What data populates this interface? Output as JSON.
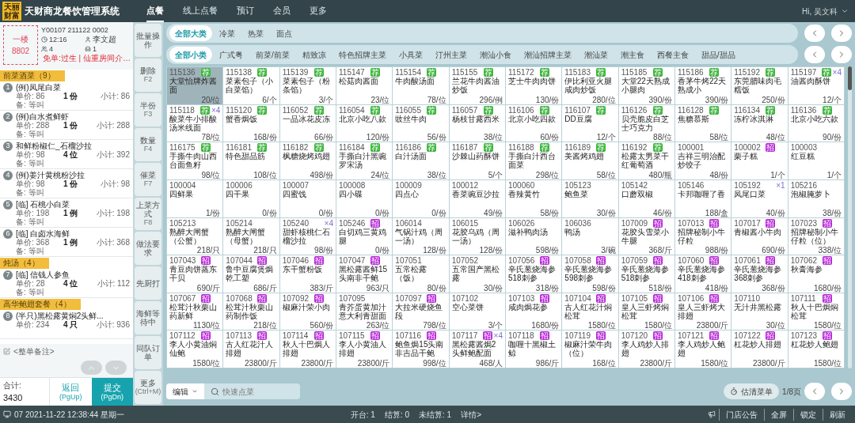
{
  "logo_lines": [
    "天丽",
    "财富"
  ],
  "title": "天财商龙餐饮管理系统",
  "nav": [
    {
      "label": "点餐",
      "selected": true
    },
    {
      "label": "线上点餐",
      "selected": false
    },
    {
      "label": "预订",
      "selected": false
    },
    {
      "label": "会员",
      "selected": false
    },
    {
      "label": "更多",
      "selected": false
    }
  ],
  "user": "Hi, 吴文科",
  "order": {
    "table_area": "一楼",
    "table_no": "8802",
    "bill_no": "Y00107 211122 0002",
    "time": "12:16",
    "waiter": "李文超",
    "guests": "4",
    "seats": "1",
    "remark": "免单:过生 | 仙重房间介…"
  },
  "groups": [
    {
      "title": "前菜酒菜（9）",
      "items": [
        {
          "index": "1",
          "name": "(例)凤尾白菜",
          "unit_price": "单价: 86",
          "qty": "1 份",
          "subtotal": "小计: 86",
          "note": "备: 等叫"
        },
        {
          "index": "2",
          "name": "(例)白水煮鲜虾",
          "unit_price": "单价: 288",
          "qty": "1 份",
          "subtotal": "小计: 288",
          "note": "备: 等叫"
        },
        {
          "index": "3",
          "name": "和鲜粉椒仁_石榴沙拉",
          "unit_price": "单价: 98",
          "qty": "4 位",
          "subtotal": "小计: 392",
          "note": "备: 等叫"
        },
        {
          "index": "4",
          "name": "(例)姜汁黄桃粉沙拉",
          "unit_price": "单价: 98",
          "qty": "1 份",
          "subtotal": "小计: 98",
          "note": "备: 等叫"
        },
        {
          "index": "5",
          "name": "[临] 石桃小白菜",
          "unit_price": "单价: 198",
          "qty": "1 例",
          "subtotal": "小计: 198",
          "note": "备: 等叫"
        },
        {
          "index": "6",
          "name": "[临] 白卤水海鲜",
          "unit_price": "单价: 368",
          "qty": "1 例",
          "subtotal": "小计: 368",
          "note": "备: 等叫"
        }
      ]
    },
    {
      "title": "炖汤（4）",
      "items": [
        {
          "index": "7",
          "name": "[临] 信钱人参鱼",
          "unit_price": "单价: 28",
          "qty": "4 位",
          "subtotal": "小计: 112",
          "note": "备: 等叫"
        }
      ]
    },
    {
      "title": "高华鲍翅套餐（4）",
      "items": [
        {
          "index": "8",
          "name": "(半只)黑松露黄焖2头鲜...",
          "unit_price": "单价: 234",
          "qty": "4 只",
          "subtotal": "小计: 936"
        }
      ]
    }
  ],
  "order_note": "<整单备注>",
  "total_label": "合计:",
  "total": "3430",
  "buttons": [
    {
      "label": "返回",
      "key": "(PgUp)",
      "kind": "secondary"
    },
    {
      "label": "提交",
      "key": "(PgDn)",
      "kind": "primary"
    }
  ],
  "actions": [
    {
      "label": "批量操作"
    },
    {
      "label": "删除",
      "key": "F2"
    },
    {
      "label": "半份",
      "key": "F3"
    },
    {
      "label": "数量",
      "key": "F4"
    },
    {
      "label": "催菜",
      "key": "F7"
    },
    {
      "label": "上菜方式",
      "key": "F8"
    },
    {
      "label": "做法要求"
    },
    {
      "label": "先厨打"
    },
    {
      "label": "海鲜等待中"
    },
    {
      "label": "同队订单"
    },
    {
      "label": "更多",
      "key": "(Ctrl+M)"
    }
  ],
  "categories": [
    {
      "label": "全部大类",
      "selected": true
    },
    {
      "label": "冷菜",
      "selected": false
    },
    {
      "label": "热菜",
      "selected": false
    },
    {
      "label": "面点",
      "selected": false
    }
  ],
  "subcategories": [
    {
      "label": "全部小类",
      "selected": true
    },
    {
      "label": "广式粤",
      "selected": false
    },
    {
      "label": "前菜/前菜",
      "selected": false
    },
    {
      "label": "精致凉",
      "selected": false
    },
    {
      "label": "特色招牌主菜",
      "selected": false
    },
    {
      "label": "小具菜",
      "selected": false
    },
    {
      "label": "汀州主菜",
      "selected": false
    },
    {
      "label": "潮汕小食",
      "selected": false
    },
    {
      "label": "潮汕招牌主菜",
      "selected": false
    },
    {
      "label": "潮汕菜",
      "selected": false
    },
    {
      "label": "潮主食",
      "selected": false
    },
    {
      "label": "西餐主食",
      "selected": false
    },
    {
      "label": "甜品/甜品",
      "selected": false
    }
  ],
  "dishes": [
    {
      "code": "115136",
      "name": "大堂怡牌炸酱面",
      "price": "20/位",
      "tag": {
        "text": "荐",
        "color": "#3cb43c"
      },
      "selected": true
    },
    {
      "code": "115138",
      "name": "菜素包子（小白菜馅）",
      "price": "6/个",
      "tag": {
        "text": "荐",
        "color": "#3cb43c"
      },
      "selected": false
    },
    {
      "code": "115139",
      "name": "菜素包子（粉条馅）",
      "price": "3/个",
      "tag": {
        "text": "荐",
        "color": "#3cb43c"
      },
      "selected": false
    },
    {
      "code": "115147",
      "name": "松菇肉酱面",
      "price": "23/位",
      "tag": {
        "text": "荐",
        "color": "#3cb43c"
      },
      "selected": false
    },
    {
      "code": "115154",
      "name": "牛肉酸汤面",
      "price": "78/位",
      "tag": {
        "text": "荐",
        "color": "#3cb43c"
      },
      "selected": false
    },
    {
      "code": "115155",
      "name": "兰花牛肉酱油炒饭",
      "price": "296/例",
      "tag": {
        "text": "荐",
        "color": "#3cb43c"
      },
      "selected": false
    },
    {
      "code": "115172",
      "name": "芝士牛肉肉饼",
      "price": "130/份",
      "tag": {
        "text": "荐",
        "color": "#3cb43c"
      },
      "selected": false
    },
    {
      "code": "115183",
      "name": "伊比利亚火腿咸肉炒饭",
      "price": "280/位",
      "tag": {
        "text": "荐",
        "color": "#3cb43c"
      },
      "selected": false
    },
    {
      "code": "115185",
      "name": "大堂22天熟成小腿肉",
      "price": "390/份",
      "tag": {
        "text": "荐",
        "color": "#3cb43c"
      },
      "selected": false
    },
    {
      "code": "115186",
      "name": "香茅牛烤22天熟成小",
      "price": "390/份",
      "tag": {
        "text": "荐",
        "color": "#3cb43c"
      },
      "selected": false
    },
    {
      "code": "115192",
      "name": "东莞腊味肉毛糯饭",
      "price": "250/份",
      "tag": {
        "text": "荐",
        "color": "#3cb43c"
      },
      "selected": false
    },
    {
      "code": "115197",
      "name": "油酱肉酥饼",
      "price": "12/个",
      "tag": {
        "text": "荐",
        "color": "#3cb43c"
      },
      "qty": "×4",
      "selected": false
    },
    {
      "code": "115118",
      "name": "酸菜牛小排酸汤米线面",
      "price": "78/位",
      "tag": {
        "text": "荐",
        "color": "#3cb43c"
      },
      "qty": "×4",
      "selected": false
    },
    {
      "code": "115120",
      "name": "蟹香焗饭",
      "price": "168/份",
      "tag": {
        "text": "荐",
        "color": "#3cb43c"
      },
      "selected": false
    },
    {
      "code": "116052",
      "name": "一品冰花皮冻",
      "price": "66/份",
      "tag": {
        "text": "荐",
        "color": "#3cb43c"
      },
      "selected": false
    },
    {
      "code": "116054",
      "name": "北京小吃八款",
      "price": "120/份",
      "tag": {
        "text": "荐",
        "color": "#3cb43c"
      },
      "selected": false
    },
    {
      "code": "116055",
      "name": "豉丝牛肉",
      "price": "56/份",
      "tag": {
        "text": "荐",
        "color": "#3cb43c"
      },
      "selected": false
    },
    {
      "code": "116057",
      "name": "杨枝甘露西米",
      "price": "38/位",
      "tag": {
        "text": "荐",
        "color": "#3cb43c"
      },
      "selected": false
    },
    {
      "code": "116106",
      "name": "北京小吃四款",
      "price": "60/份",
      "tag": {
        "text": "荐",
        "color": "#3cb43c"
      },
      "selected": false
    },
    {
      "code": "116107",
      "name": "DD豆腐",
      "price": "12/个",
      "tag": {
        "text": "荐",
        "color": "#3cb43c"
      },
      "selected": false
    },
    {
      "code": "116126",
      "name": "贝壳脆皮白芝士巧克力",
      "price": "88/位",
      "tag": {
        "text": "荐",
        "color": "#3cb43c"
      },
      "selected": false
    },
    {
      "code": "116128",
      "name": "焦糖慕斯",
      "price": "58/位",
      "tag": {
        "text": "荐",
        "color": "#3cb43c"
      },
      "selected": false
    },
    {
      "code": "116134",
      "name": "冻柠冰淇淋",
      "price": "48/位",
      "tag": {
        "text": "荐",
        "color": "#3cb43c"
      },
      "selected": false
    },
    {
      "code": "116136",
      "name": "北京小吃六款",
      "price": "90/份",
      "tag": {
        "text": "荐",
        "color": "#3cb43c"
      },
      "selected": false
    },
    {
      "code": "116175",
      "name": "手撕牛肉山西台面鱼籽",
      "price": "98/位",
      "tag": {
        "text": "荐",
        "color": "#3cb43c"
      },
      "selected": false
    },
    {
      "code": "116181",
      "name": "特色甜品筋",
      "price": "108/位",
      "tag": {
        "text": "荐",
        "color": "#3cb43c"
      },
      "selected": false
    },
    {
      "code": "116182",
      "name": "枫糖烧烤鸡翅",
      "price": "498/份",
      "tag": {
        "text": "荐",
        "color": "#3cb43c"
      },
      "selected": false
    },
    {
      "code": "116184",
      "name": "手撕白汁黑豌罗宋汤",
      "price": "24/位",
      "tag": {
        "text": "荐",
        "color": "#3cb43c"
      },
      "selected": false
    },
    {
      "code": "116186",
      "name": "白汁汤面",
      "price": "38/位",
      "tag": {
        "text": "荐",
        "color": "#3cb43c"
      },
      "selected": false
    },
    {
      "code": "116187",
      "name": "沙棘山药酥饼",
      "price": "5/个",
      "tag": {
        "text": "荐",
        "color": "#3cb43c"
      },
      "selected": false
    },
    {
      "code": "116188",
      "name": "手撕白汁西台面菜",
      "price": "298/位",
      "tag": {
        "text": "荐",
        "color": "#3cb43c"
      },
      "selected": false
    },
    {
      "code": "116189",
      "name": "美酱烤鸡翅",
      "price": "58/位",
      "tag": {
        "text": "荐",
        "color": "#3cb43c"
      },
      "selected": false
    },
    {
      "code": "116192",
      "name": "松露太男菜干红葡萄酒",
      "price": "480/瓶",
      "tag": {
        "text": "荐",
        "color": "#3cb43c"
      },
      "selected": false
    },
    {
      "code": "100001",
      "name": "吉祥三明治配炒饺子",
      "price": "48/份",
      "selected": false
    },
    {
      "code": "100002",
      "name": "栗子糕",
      "price": "1/个",
      "tag": {
        "text": "招",
        "color": "#b726d6"
      },
      "selected": false
    },
    {
      "code": "100003",
      "name": "红豆糕",
      "price": "1/个",
      "selected": false
    },
    {
      "code": "100004",
      "name": "四鲜果",
      "price": "1/份",
      "selected": false
    },
    {
      "code": "100006",
      "name": "四干果",
      "price": "0/份",
      "selected": false
    },
    {
      "code": "100007",
      "name": "四蜜饯",
      "price": "0/份",
      "selected": false
    },
    {
      "code": "100008",
      "name": "四小碟",
      "price": "0/份",
      "selected": false
    },
    {
      "code": "100009",
      "name": "四点心",
      "price": "0/份",
      "selected": false
    },
    {
      "code": "100012",
      "name": "香菜豌豆沙拉",
      "price": "49/份",
      "selected": false
    },
    {
      "code": "100060",
      "name": "香辣黄竹",
      "price": "58/份",
      "selected": false
    },
    {
      "code": "105123",
      "name": "鲍鱼菜",
      "price": "30/份",
      "selected": false
    },
    {
      "code": "105142",
      "name": "口蘑双椒",
      "price": "46/份",
      "selected": false
    },
    {
      "code": "105146",
      "name": "卡邦咖喱了香",
      "price": "188/盒",
      "selected": false
    },
    {
      "code": "105192",
      "name": "凤尾口菜",
      "price": "40/份",
      "qty": "×1",
      "selected": false
    },
    {
      "code": "105216",
      "name": "泡椒腌萝卜",
      "price": "38/份",
      "selected": false
    },
    {
      "code": "105213",
      "name": "熟醉大闸蟹（公蟹）",
      "price": "218/只",
      "selected": false
    },
    {
      "code": "105214",
      "name": "熟醉大闸蟹（母蟹）",
      "price": "218/只",
      "selected": false
    },
    {
      "code": "105240",
      "name": "甜虾核桃仁石榴沙拉",
      "price": "98/份",
      "qty": "×4",
      "selected": false
    },
    {
      "code": "105246",
      "name": "白切鸡三黄鸡腿",
      "price": "0/份",
      "tag": {
        "text": "招",
        "color": "#b726d6"
      },
      "selected": false
    },
    {
      "code": "106014",
      "name": "气锅汁鸡（周一汤）",
      "price": "128/份",
      "selected": false
    },
    {
      "code": "106015",
      "name": "花胶乌鸡（周一汤）",
      "price": "128/份",
      "selected": false
    },
    {
      "code": "106026",
      "name": "滋补鸭肉汤",
      "price": "598/份",
      "selected": false
    },
    {
      "code": "106036",
      "name": "鸭汤",
      "price": "3/碗",
      "selected": false
    },
    {
      "code": "107009",
      "name": "花胶头雪菜小牛腿",
      "price": "368/斤",
      "tag": {
        "text": "招",
        "color": "#b726d6"
      },
      "selected": false
    },
    {
      "code": "107013",
      "name": "招牌秘制小牛仔粒",
      "price": "988/份",
      "tag": {
        "text": "招",
        "color": "#b726d6"
      },
      "selected": false
    },
    {
      "code": "107017",
      "name": "青椒酱小牛肉",
      "price": "690/份",
      "tag": {
        "text": "招",
        "color": "#b726d6"
      },
      "selected": false
    },
    {
      "code": "107023",
      "name": "招牌秘制小牛仔粒（位）",
      "price": "338/位",
      "tag": {
        "text": "招",
        "color": "#b726d6"
      },
      "selected": false
    },
    {
      "code": "107043",
      "name": "青豆肉饼蒸东干贝",
      "price": "690/斤",
      "tag": {
        "text": "招",
        "color": "#b726d6"
      },
      "selected": false
    },
    {
      "code": "107044",
      "name": "鲁中豆腐煲焗乾工塑",
      "price": "686/斤",
      "tag": {
        "text": "招",
        "color": "#b726d6"
      },
      "selected": false
    },
    {
      "code": "107046",
      "name": "东干蟹粉饭",
      "price": "383/斤",
      "tag": {
        "text": "招",
        "color": "#b726d6"
      },
      "selected": false
    },
    {
      "code": "107047",
      "name": "黑松露酱鲜15头南非干鲍",
      "price": "963/只",
      "tag": {
        "text": "招",
        "color": "#b726d6"
      },
      "selected": false
    },
    {
      "code": "107051",
      "name": "五常松露（饭）",
      "price": "80/份",
      "selected": false
    },
    {
      "code": "107052",
      "name": "五常国产黑松露",
      "price": "30/份",
      "selected": false
    },
    {
      "code": "107056",
      "name": "辛氏葱烧海参518刺参",
      "price": "318/份",
      "tag": {
        "text": "招",
        "color": "#b726d6"
      },
      "selected": false
    },
    {
      "code": "107058",
      "name": "辛氏葱烧海参598刺参",
      "price": "598/份",
      "tag": {
        "text": "招",
        "color": "#b726d6"
      },
      "selected": false
    },
    {
      "code": "107059",
      "name": "辛氏葱烧海参518刺参",
      "price": "518/份",
      "tag": {
        "text": "招",
        "color": "#b726d6"
      },
      "selected": false
    },
    {
      "code": "107060",
      "name": "辛氏葱烧海参418刺参",
      "price": "418/份",
      "tag": {
        "text": "招",
        "color": "#b726d6"
      },
      "selected": false
    },
    {
      "code": "107061",
      "name": "辛氏葱烧海参368刺参",
      "price": "368/份",
      "tag": {
        "text": "招",
        "color": "#b726d6"
      },
      "selected": false
    },
    {
      "code": "107062",
      "name": "秋膏海参",
      "price": "1680/份",
      "tag": {
        "text": "招",
        "color": "#b726d6"
      },
      "selected": false
    },
    {
      "code": "107067",
      "name": "松茸汁秋栗山药新鲜",
      "price": "1130/位",
      "tag": {
        "text": "招",
        "color": "#b726d6"
      },
      "selected": false
    },
    {
      "code": "107068",
      "name": "松茸汁秋栗山药制作饭",
      "price": "218/位",
      "tag": {
        "text": "招",
        "color": "#b726d6"
      },
      "selected": false
    },
    {
      "code": "107092",
      "name": "椒麻汁荣小肉",
      "price": "560/份",
      "tag": {
        "text": "招",
        "color": "#b726d6"
      },
      "selected": false
    },
    {
      "code": "107095",
      "name": "青芥蛋黄加汁意大利青甜面",
      "price": "263/位",
      "selected": false
    },
    {
      "code": "107097",
      "name": "大拉米硬烧鱼段",
      "price": "798/位",
      "tag": {
        "text": "招",
        "color": "#b726d6"
      },
      "selected": false
    },
    {
      "code": "107102",
      "name": "空心菜饼",
      "price": "3/个",
      "selected": false
    },
    {
      "code": "107103",
      "name": "咸肉焗花参",
      "price": "1680/份",
      "tag": {
        "text": "招",
        "color": "#b726d6"
      },
      "selected": false
    },
    {
      "code": "107104",
      "name": "古人红花汁焖松茸",
      "price": "1580/位",
      "tag": {
        "text": "招",
        "color": "#b726d6"
      },
      "selected": false
    },
    {
      "code": "107105",
      "name": "皇人三虾烤焖松茸",
      "price": "1580/位",
      "tag": {
        "text": "招",
        "color": "#b726d6"
      },
      "selected": false
    },
    {
      "code": "107106",
      "name": "皇人三虾烤大排翅",
      "price": "23800/斤",
      "tag": {
        "text": "招",
        "color": "#b726d6"
      },
      "selected": false
    },
    {
      "code": "107110",
      "name": "无汁井黑松露",
      "price": "30/位",
      "selected": false
    },
    {
      "code": "107111",
      "name": "秋人十巴焗焖松茸",
      "price": "1580/位",
      "tag": {
        "text": "招",
        "color": "#b726d6"
      },
      "selected": false
    },
    {
      "code": "107112",
      "name": "李人小黄油焖仙鲍",
      "price": "1580/位",
      "tag": {
        "text": "招",
        "color": "#b726d6"
      },
      "selected": false
    },
    {
      "code": "107113",
      "name": "古人红花汁人排翅",
      "price": "23800/斤",
      "tag": {
        "text": "招",
        "color": "#b726d6"
      },
      "selected": false
    },
    {
      "code": "107114",
      "name": "秋人十巴焗人排翅",
      "price": "23800/斤",
      "tag": {
        "text": "招",
        "color": "#b726d6"
      },
      "selected": false
    },
    {
      "code": "107115",
      "name": "李人小黄油人排翅",
      "price": "23800/斤",
      "tag": {
        "text": "招",
        "color": "#b726d6"
      },
      "selected": false
    },
    {
      "code": "107116",
      "name": "鲍鱼焗15头南非吉品干鲍",
      "price": "998/位",
      "tag": {
        "text": "招",
        "color": "#b726d6"
      },
      "selected": false
    },
    {
      "code": "107117",
      "name": "黑松露酱焗2头鲜鲍配面",
      "price": "468/人",
      "tag": {
        "text": "招",
        "color": "#b726d6"
      },
      "qty": "×4",
      "selected": false
    },
    {
      "code": "107118",
      "name": "咖喱十黑椒土鲸",
      "price": "986/斤",
      "tag": {
        "text": "招",
        "color": "#b726d6"
      },
      "selected": false
    },
    {
      "code": "107119",
      "name": "椒麻汁荣牛肉（位）",
      "price": "168/位",
      "tag": {
        "text": "招",
        "color": "#b726d6"
      },
      "selected": false
    },
    {
      "code": "107120",
      "name": "李人鸡炒人排翅",
      "price": "23800/斤",
      "tag": {
        "text": "招",
        "color": "#b726d6"
      },
      "selected": false
    },
    {
      "code": "107121",
      "name": "李人鸡炒人鲍翅",
      "price": "1580/位",
      "tag": {
        "text": "招",
        "color": "#b726d6"
      },
      "selected": false
    },
    {
      "code": "107122",
      "name": "杠花炒人排翅",
      "price": "23800/斤",
      "tag": {
        "text": "招",
        "color": "#b726d6"
      },
      "selected": false
    },
    {
      "code": "107123",
      "name": "杠花炒人鲍翅",
      "price": "1580/位",
      "tag": {
        "text": "招",
        "color": "#b726d6"
      },
      "selected": false
    }
  ],
  "toolbar": {
    "dropdown": "编辑",
    "search_placeholder": "快速点菜",
    "soldout_button": "估清菜单",
    "page": "1/8页"
  },
  "status": {
    "terminal": "07 2021-11-22 12:38:44 星期一",
    "stats": [
      {
        "label": "开台:",
        "value": "1"
      },
      {
        "label": "结算:",
        "value": "0"
      },
      {
        "label": "未结算:",
        "value": "1"
      }
    ],
    "details": "详情>",
    "links": [
      "门店公告",
      "全屏",
      "锁定",
      "刷新"
    ]
  }
}
